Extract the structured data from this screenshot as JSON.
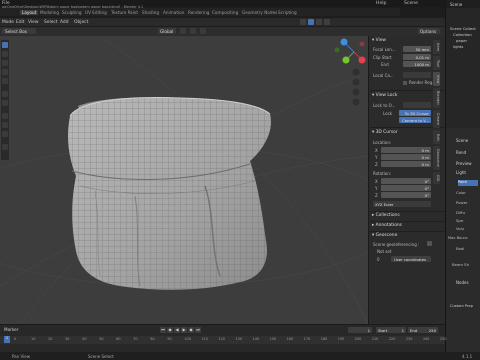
{
  "app": {
    "title": "Blender 4.1",
    "filepath": "ap\\OneDrive\\Desktop\\WIP\\Bakery paper bag\\bakery paper bag.blend] - Blender 4.1"
  },
  "topbar": {
    "file": "File",
    "help": "Help",
    "scene": "Scene"
  },
  "workspace_tabs": [
    {
      "label": "Layout",
      "active": true
    },
    {
      "label": "Modeling",
      "active": false
    },
    {
      "label": "Sculpting",
      "active": false
    },
    {
      "label": "UV Editing",
      "active": false
    },
    {
      "label": "Texture Paint",
      "active": false
    },
    {
      "label": "Shading",
      "active": false
    },
    {
      "label": "Animation",
      "active": false
    },
    {
      "label": "Rendering",
      "active": false
    },
    {
      "label": "Compositing",
      "active": false
    },
    {
      "label": "Geometry Nodes",
      "active": false
    },
    {
      "label": "Scripting",
      "active": false
    }
  ],
  "menubar": [
    "Edit",
    "View",
    "Select",
    "Add",
    "Object"
  ],
  "mode_label": "Mode",
  "header": {
    "select_box": "Select Box",
    "global": "Global",
    "options": "Options"
  },
  "npanel": {
    "view_section": "View",
    "focal_length_label": "Focal Len...",
    "focal_length": "50 mm",
    "clip_start_label": "Clip Start",
    "clip_start": "0.01 m",
    "clip_end_label": "End",
    "clip_end": "1000 m",
    "local_camera_label": "Local Ca...",
    "render_region": "Render Reg...",
    "view_lock_section": "View Lock",
    "lock_to_object_label": "Lock to O...",
    "lock_label": "Lock",
    "to_3d_cursor": "To 3D Cursor",
    "camera_to_view": "Camera to V...",
    "cursor_section": "3D Cursor",
    "location_label": "Location:",
    "loc_x_label": "X",
    "loc_x": "0 m",
    "loc_y_label": "Y",
    "loc_y": "0 m",
    "loc_z_label": "Z",
    "loc_z": "0 m",
    "rotation_label": "Rotation:",
    "rot_x_label": "X",
    "rot_x": "0°",
    "rot_y_label": "Y",
    "rot_y": "0°",
    "rot_z_label": "Z",
    "rot_z": "0°",
    "rotation_mode": "XYZ Euler",
    "collections_section": "Collections",
    "annotations_section": "Annotations",
    "geoscene_section": "Geoscene",
    "geoscene_label": "Scene georeferencing :",
    "not_set": "Not set",
    "geoscene_value": "0",
    "geoscene_btn": "User coordinates"
  },
  "vtabs": [
    "Item",
    "Tool",
    "View",
    "Blender",
    "Create",
    "Edit",
    "Geoscene",
    "GIS"
  ],
  "outliner": {
    "items": [
      "Scene Collect",
      "Collection",
      "paper",
      "lights",
      "View Layer"
    ]
  },
  "properties": {
    "scene_label": "Scene",
    "tab": "Rend",
    "preview": "Preview",
    "light": "Light",
    "point": "Point",
    "color": "Color",
    "power": "Power",
    "diffuse": "Diffu",
    "specular": "Spe",
    "volume": "Volu",
    "max_bounces": "Max Bounc",
    "radius": "Radi",
    "beam_shape": "Beam Sh",
    "nodes": "Nodes",
    "custom_properties": "Custom Prop"
  },
  "timeline": {
    "marker": "Marker",
    "playback": "Playback",
    "keying": "Keying",
    "view": "View",
    "current_frame": "1",
    "start_label": "Start",
    "start": "1",
    "end_label": "End",
    "end": "250",
    "ticks": [
      "0",
      "10",
      "20",
      "30",
      "40",
      "50",
      "60",
      "70",
      "80",
      "90",
      "100",
      "110",
      "120",
      "130",
      "140",
      "150",
      "160",
      "170",
      "180",
      "190",
      "200",
      "210",
      "220",
      "230",
      "240",
      "250"
    ]
  },
  "status": {
    "pan_view": "Pan View",
    "scene_select": "Scene Select",
    "version": "4.1.1"
  },
  "colors": {
    "accent_blue": "#4772b3",
    "viewport_bg": "#3d3d3d",
    "axis_red": "#e2414e",
    "axis_green": "#73c72b",
    "axis_blue": "#3a8fe4"
  }
}
